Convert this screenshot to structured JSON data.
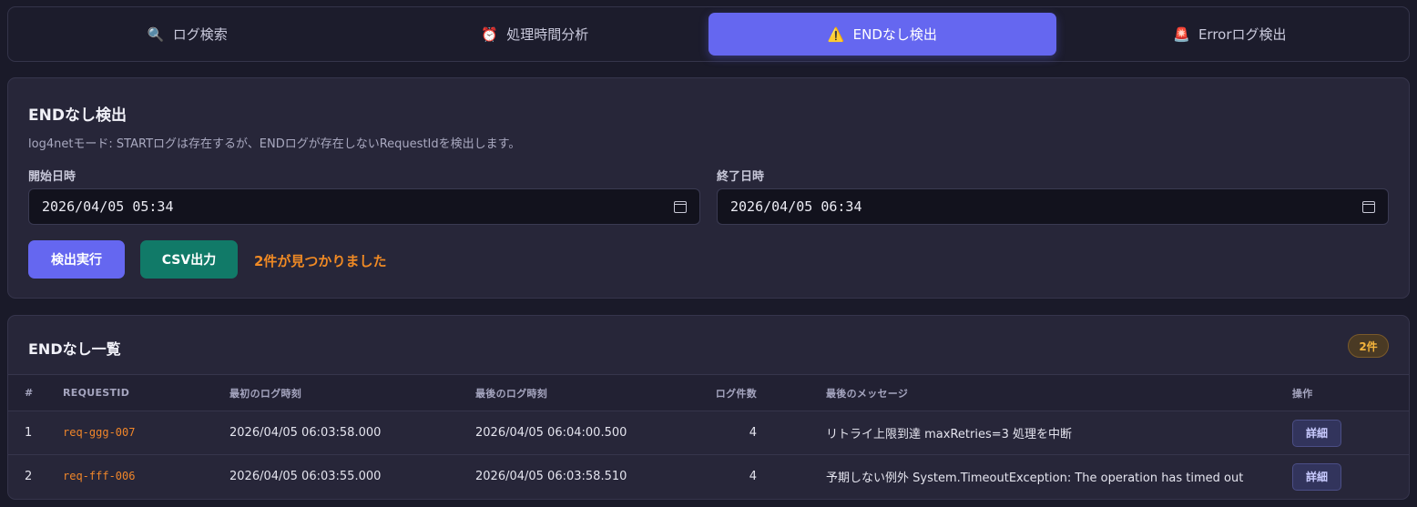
{
  "tabs": [
    {
      "label": "ログ検索",
      "icon": "🔍",
      "active": false
    },
    {
      "label": "処理時間分析",
      "icon": "⏰",
      "active": false
    },
    {
      "label": "ENDなし検出",
      "icon": "⚠️",
      "active": true
    },
    {
      "label": "Errorログ検出",
      "icon": "🚨",
      "active": false
    }
  ],
  "search": {
    "title": "ENDなし検出",
    "description": "log4netモード: STARTログは存在するが、ENDログが存在しないRequestIdを検出します。",
    "start_label": "開始日時",
    "start_value": "2026/04/05  05:34",
    "end_label": "終了日時",
    "end_value": "2026/04/05  06:34",
    "run_label": "検出実行",
    "csv_label": "CSV出力",
    "result_text": "2件が見つかりました"
  },
  "list": {
    "title": "ENDなし一覧",
    "count_badge": "2件",
    "columns": [
      "#",
      "REQUESTID",
      "最初のログ時刻",
      "最後のログ時刻",
      "ログ件数",
      "最後のメッセージ",
      "操作"
    ],
    "rows": [
      {
        "idx": "1",
        "request_id": "req-ggg-007",
        "first": "2026/04/05 06:03:58.000",
        "last": "2026/04/05 06:04:00.500",
        "count": "4",
        "message": "リトライ上限到達 maxRetries=3 処理を中断",
        "action": "詳細"
      },
      {
        "idx": "2",
        "request_id": "req-fff-006",
        "first": "2026/04/05 06:03:55.000",
        "last": "2026/04/05 06:03:58.510",
        "count": "4",
        "message": "予期しない例外 System.TimeoutException: The operation has timed out",
        "action": "詳細"
      }
    ]
  },
  "colors": {
    "accent": "#6567f0",
    "csv": "#117a68",
    "result": "#f08a24",
    "request_id": "#f0862a"
  }
}
